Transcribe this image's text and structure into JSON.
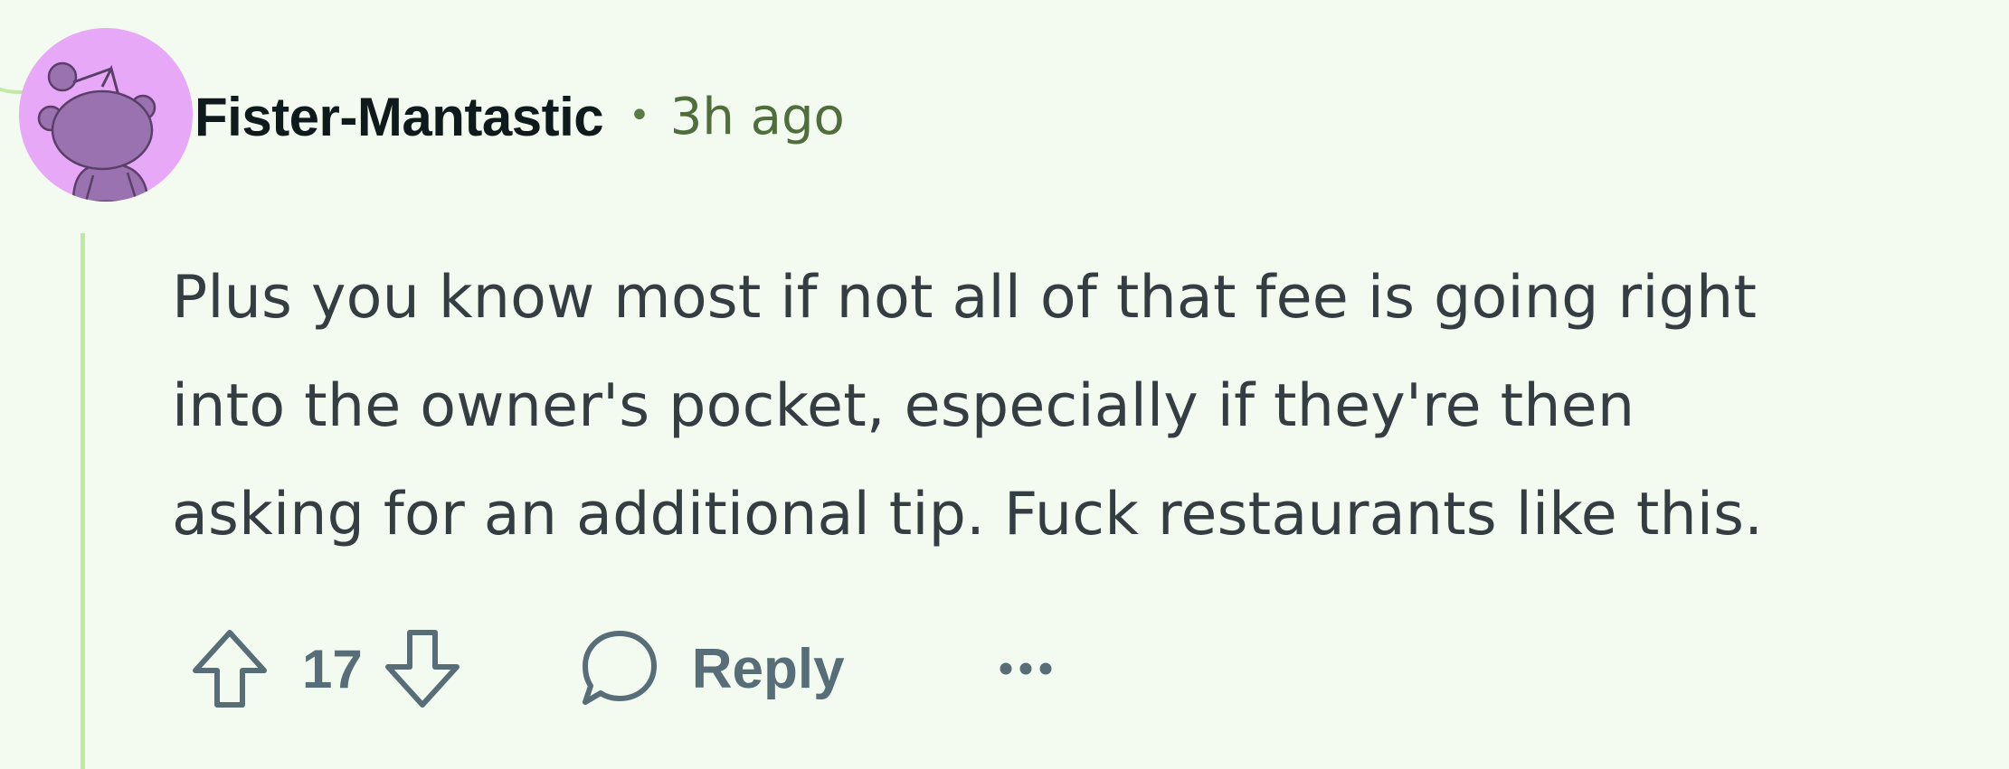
{
  "comment": {
    "author": "Fister-Mantastic",
    "separator": "•",
    "timestamp": "3h ago",
    "body_lines": [
      "Plus you know most if not all of that fee is going right",
      "into the owner's pocket, especially if they're then",
      "asking for an additional tip. Fuck restaurants like this."
    ]
  },
  "actions": {
    "vote_count": "17",
    "reply_label": "Reply"
  },
  "colors": {
    "background": "#f3faef",
    "thread_line": "#c2e8a6",
    "avatar_bg": "#e6a8f7",
    "avatar_figure": "#9b72b0",
    "username": "#0f1a1c",
    "timestamp": "#4f6e3c",
    "body_text": "#333d42",
    "action_text": "#576d77"
  },
  "icons": {
    "avatar": "snoo-avatar",
    "upvote": "upvote-arrow-icon",
    "downvote": "downvote-arrow-icon",
    "reply": "comment-bubble-icon",
    "more": "more-options-icon"
  }
}
